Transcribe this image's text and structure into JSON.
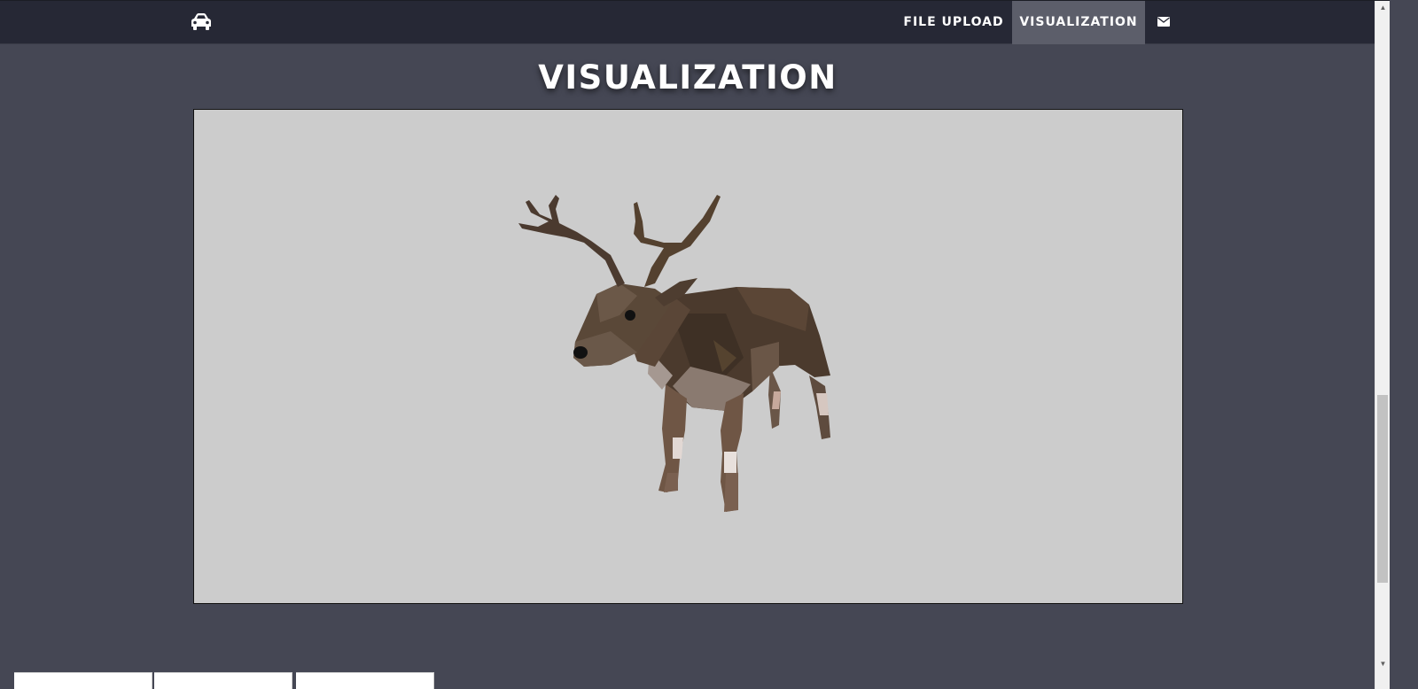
{
  "navbar": {
    "brand_icon": "car-icon",
    "links": [
      {
        "label": "FILE UPLOAD",
        "active": false
      },
      {
        "label": "VISUALIZATION",
        "active": true
      }
    ],
    "mail_icon": "envelope-icon"
  },
  "page": {
    "title": "VISUALIZATION"
  },
  "viewer": {
    "content": "deer-3d-model-icon"
  },
  "colors": {
    "page_bg": "#454754",
    "navbar_bg": "#262835",
    "active_tab_bg": "#5c5e6a",
    "viewport_bg": "#cccccc",
    "text": "#ffffff"
  }
}
